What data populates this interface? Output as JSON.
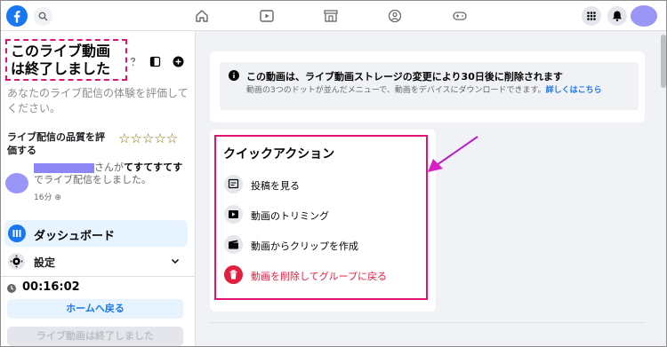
{
  "left_panel": {
    "title": "このライブ動画は終了しました",
    "subtitle": "あなたのライブ配信の体験を評価してください。",
    "rate_label": "ライブ配信の品質を評価する",
    "stars": "☆☆☆☆☆",
    "activity": {
      "text_mid": "さんが",
      "post_name": "てすてすてす",
      "text_end": "でライブ配信をしました。",
      "time": "16分"
    },
    "dashboard_label": "ダッシュボード",
    "settings_label": "設定",
    "timer": "00:16:02",
    "home_button": "ホームへ戻る",
    "ended_button": "ライブ動画は終了しました"
  },
  "notice": {
    "title": "この動画は、ライブ動画ストレージの変更により30日後に削除されます",
    "body": "動画の3つのドットが並んだメニューで、動画をデバイスにダウンロードできます。",
    "link": "詳しくはこちら"
  },
  "quick_actions": {
    "title": "クイックアクション",
    "items": [
      {
        "label": "投稿を見る",
        "icon": "post-icon"
      },
      {
        "label": "動画のトリミング",
        "icon": "trim-icon"
      },
      {
        "label": "動画からクリップを作成",
        "icon": "clip-icon"
      },
      {
        "label": "動画を削除してグループに戻る",
        "icon": "trash-icon"
      }
    ]
  },
  "colors": {
    "brand": "#1877f2",
    "highlight": "#e0146e",
    "danger": "#e41e3f",
    "avatar": "#9a96f7"
  }
}
